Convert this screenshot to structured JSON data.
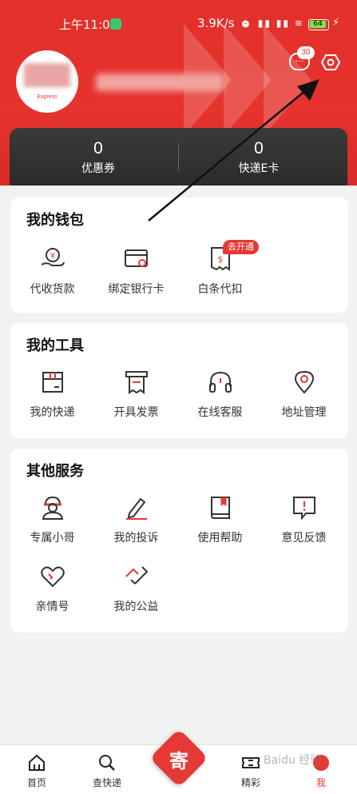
{
  "status_bar": {
    "time": "上午11:01",
    "speed": "3.9K/s",
    "battery": "64"
  },
  "header": {
    "avatar_logo": "Express",
    "messages_badge": "30"
  },
  "stats": [
    {
      "value": "0",
      "label": "优惠券"
    },
    {
      "value": "0",
      "label": "快递E卡"
    }
  ],
  "wallet": {
    "title": "我的钱包",
    "items": [
      {
        "label": "代收货款"
      },
      {
        "label": "绑定银行卡"
      },
      {
        "label": "白条代扣"
      }
    ],
    "tag": "去开通"
  },
  "tools": {
    "title": "我的工具",
    "items": [
      {
        "label": "我的快递"
      },
      {
        "label": "开具发票"
      },
      {
        "label": "在线客服"
      },
      {
        "label": "地址管理"
      }
    ]
  },
  "services": {
    "title": "其他服务",
    "items": [
      {
        "label": "专属小哥"
      },
      {
        "label": "我的投诉"
      },
      {
        "label": "使用帮助"
      },
      {
        "label": "意见反馈"
      },
      {
        "label": "亲情号"
      },
      {
        "label": "我的公益"
      }
    ]
  },
  "tabbar": {
    "items": [
      {
        "label": "首页"
      },
      {
        "label": "查快递"
      },
      {
        "label": "寄"
      },
      {
        "label": "精彩"
      },
      {
        "label": "我"
      }
    ]
  },
  "watermark": "Baidu 经验",
  "colors": {
    "brand_red": "#e53935",
    "card_dark": "#2f2f2f"
  }
}
